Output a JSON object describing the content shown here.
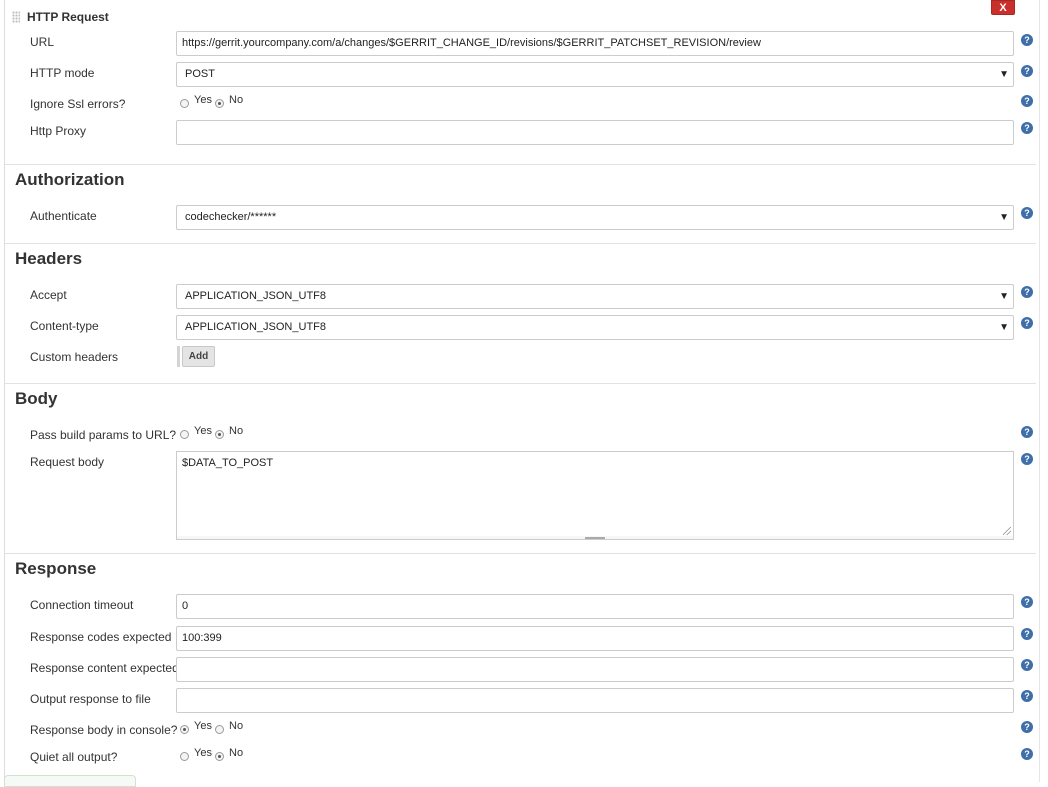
{
  "block": {
    "title": "HTTP Request",
    "close_label": "X"
  },
  "request": {
    "url_label": "URL",
    "url_value": "https://gerrit.yourcompany.com/a/changes/$GERRIT_CHANGE_ID/revisions/$GERRIT_PATCHSET_REVISION/review",
    "http_mode_label": "HTTP mode",
    "http_mode_value": "POST",
    "ignore_ssl_label": "Ignore Ssl errors?",
    "ignore_ssl_selected": "No",
    "proxy_label": "Http Proxy",
    "proxy_value": ""
  },
  "radio": {
    "yes": "Yes",
    "no": "No"
  },
  "authorization": {
    "title": "Authorization",
    "authenticate_label": "Authenticate",
    "authenticate_value": "codechecker/******"
  },
  "headers": {
    "title": "Headers",
    "accept_label": "Accept",
    "accept_value": "APPLICATION_JSON_UTF8",
    "content_type_label": "Content-type",
    "content_type_value": "APPLICATION_JSON_UTF8",
    "custom_headers_label": "Custom headers",
    "add_label": "Add"
  },
  "body": {
    "title": "Body",
    "pass_params_label": "Pass build params to URL?",
    "pass_params_selected": "No",
    "request_body_label": "Request body",
    "request_body_value": "$DATA_TO_POST"
  },
  "response": {
    "title": "Response",
    "timeout_label": "Connection timeout",
    "timeout_value": "0",
    "codes_label": "Response codes expected",
    "codes_value": "100:399",
    "content_label": "Response content expected",
    "content_value": "",
    "output_file_label": "Output response to file",
    "output_file_value": "",
    "console_label": "Response body in console?",
    "console_selected": "Yes",
    "quiet_label": "Quiet all output?",
    "quiet_selected": "No"
  },
  "help_icon_glyph": "?",
  "select_arrow_glyph": "▼",
  "colors": {
    "close_button": "#c9302c",
    "help_icon": "#3f6fa8"
  }
}
